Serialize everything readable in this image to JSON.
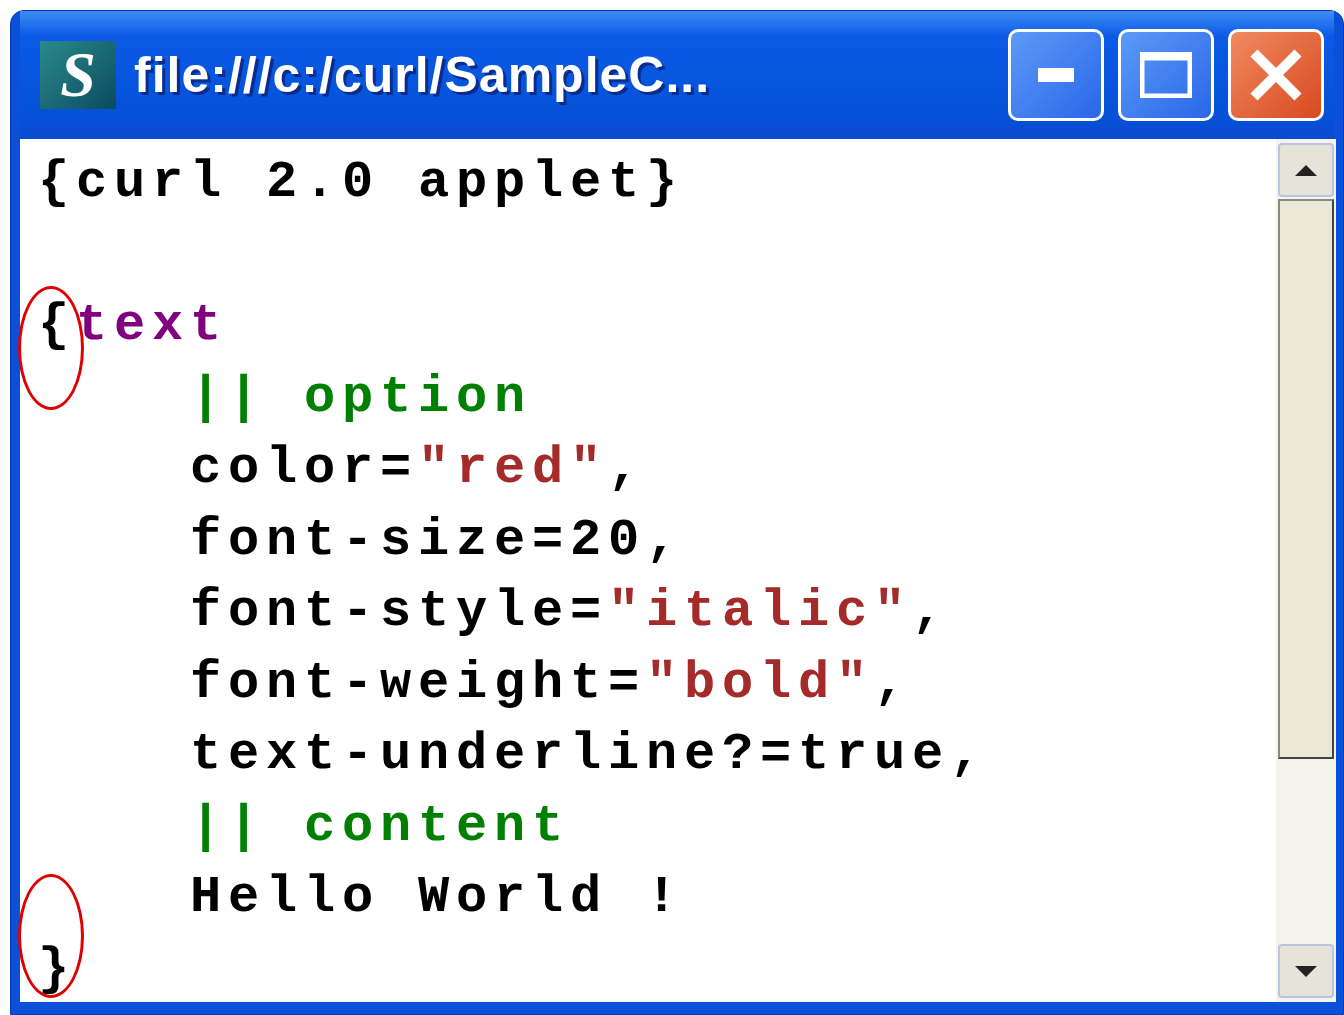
{
  "window": {
    "title": "file:///c:/curl/SampleC...",
    "app_icon": "S"
  },
  "code": {
    "lines": [
      {
        "kind": "code",
        "circled": false,
        "tokens": [
          {
            "kind": "plain",
            "text": "{curl 2.0 applet}"
          }
        ]
      },
      {
        "kind": "blank"
      },
      {
        "kind": "code",
        "circled": true,
        "tokens": [
          {
            "kind": "plain",
            "text": "{"
          },
          {
            "kind": "keyword",
            "text": "text"
          }
        ],
        "children": [
          {
            "kind": "code",
            "circled": false,
            "tokens": [
              {
                "kind": "comment",
                "text": "|| option"
              }
            ]
          },
          {
            "kind": "code",
            "circled": false,
            "tokens": [
              {
                "kind": "plain",
                "text": "color="
              },
              {
                "kind": "string",
                "text": "\"red\""
              },
              {
                "kind": "plain",
                "text": ","
              }
            ]
          },
          {
            "kind": "code",
            "circled": false,
            "tokens": [
              {
                "kind": "plain",
                "text": "font-size=20,"
              }
            ]
          },
          {
            "kind": "code",
            "circled": false,
            "tokens": [
              {
                "kind": "plain",
                "text": "font-style="
              },
              {
                "kind": "string",
                "text": "\"italic\""
              },
              {
                "kind": "plain",
                "text": ","
              }
            ]
          },
          {
            "kind": "code",
            "circled": false,
            "tokens": [
              {
                "kind": "plain",
                "text": "font-weight="
              },
              {
                "kind": "string",
                "text": "\"bold\""
              },
              {
                "kind": "plain",
                "text": ","
              }
            ]
          },
          {
            "kind": "code",
            "circled": false,
            "tokens": [
              {
                "kind": "plain",
                "text": "text-underline?=true,"
              }
            ]
          },
          {
            "kind": "code",
            "circled": false,
            "tokens": [
              {
                "kind": "comment",
                "text": "|| content"
              }
            ]
          },
          {
            "kind": "code",
            "circled": false,
            "tokens": [
              {
                "kind": "plain",
                "text": "Hello World !"
              }
            ]
          }
        ]
      },
      {
        "kind": "code",
        "circled": true,
        "tokens": [
          {
            "kind": "plain",
            "text": "}"
          }
        ]
      }
    ]
  }
}
